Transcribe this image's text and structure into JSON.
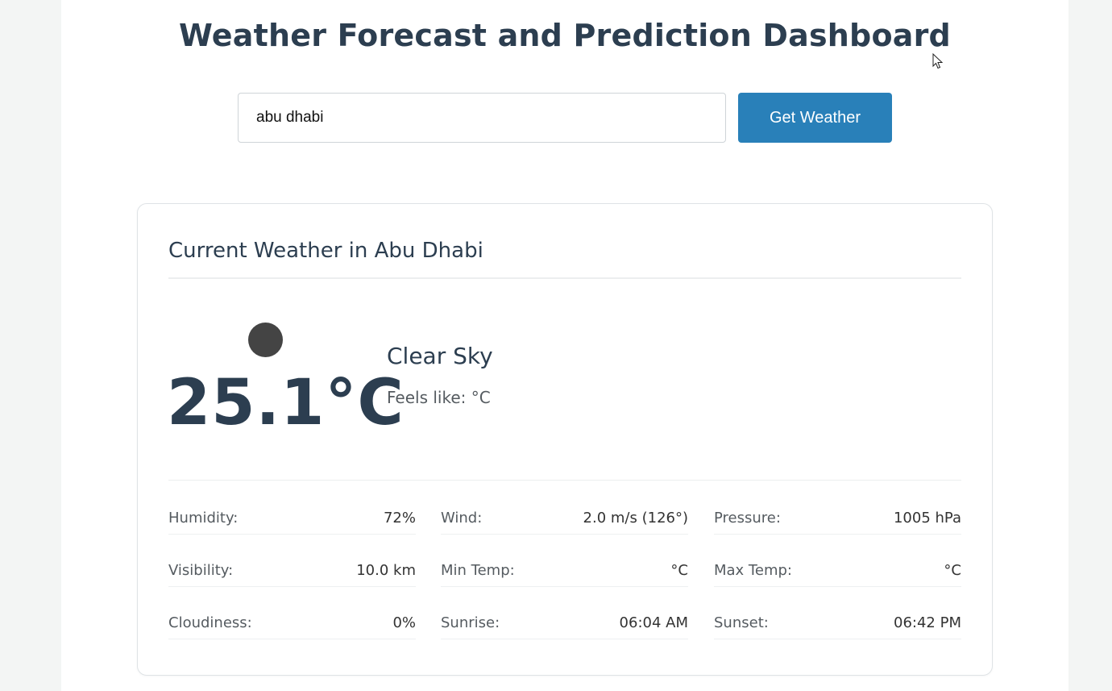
{
  "header": {
    "title": "Weather Forecast and Prediction Dashboard"
  },
  "search": {
    "value": "abu dhabi",
    "button_label": "Get Weather"
  },
  "current": {
    "title": "Current Weather in Abu Dhabi",
    "icon": "weather-condition-icon",
    "temperature": "25.1°C",
    "condition": "Clear Sky",
    "feels_like": "Feels like: °C",
    "details": [
      {
        "label": "Humidity:",
        "value": "72%"
      },
      {
        "label": "Wind:",
        "value": "2.0 m/s (126°)"
      },
      {
        "label": "Pressure:",
        "value": "1005 hPa"
      },
      {
        "label": "Visibility:",
        "value": "10.0 km"
      },
      {
        "label": "Min Temp:",
        "value": "°C"
      },
      {
        "label": "Max Temp:",
        "value": "°C"
      },
      {
        "label": "Cloudiness:",
        "value": "0%"
      },
      {
        "label": "Sunrise:",
        "value": "06:04 AM"
      },
      {
        "label": "Sunset:",
        "value": "06:42 PM"
      }
    ]
  },
  "colors": {
    "accent": "#2980b9",
    "heading": "#2c3e50",
    "background": "#f3f5f4"
  }
}
